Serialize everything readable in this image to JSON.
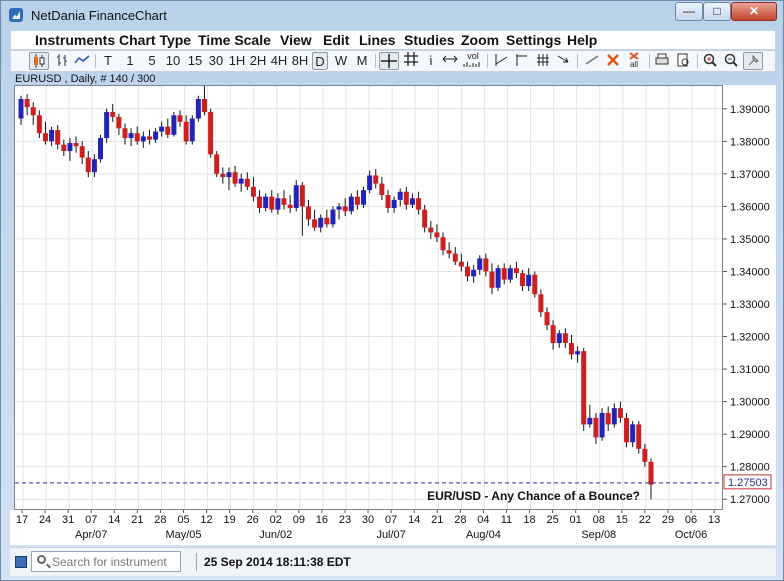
{
  "window": {
    "title": "NetDania FinanceChart",
    "buttons": {
      "minimize": "—",
      "maximize": "□",
      "close": "✕"
    }
  },
  "menu": [
    "Instruments",
    "Chart Type",
    "Time Scale",
    "View",
    "Edit",
    "Lines",
    "Studies",
    "Zoom",
    "Settings",
    "Help"
  ],
  "toolbar": {
    "timescales": [
      "T",
      "1",
      "5",
      "10",
      "15",
      "30",
      "1H",
      "2H",
      "4H",
      "8H",
      "D",
      "W",
      "M"
    ],
    "selected": "D",
    "vol_label": "vol",
    "info_label": "i",
    "all_label": "all"
  },
  "instrument_label": "EURUSD , Daily, # 140 / 300",
  "chart_data": {
    "type": "candlestick",
    "instrument": "EURUSD",
    "period": "Daily",
    "ylim": [
      1.267,
      1.397
    ],
    "y_ticks": [
      "1.39000",
      "1.38000",
      "1.37000",
      "1.36000",
      "1.35000",
      "1.34000",
      "1.33000",
      "1.32000",
      "1.31000",
      "1.30000",
      "1.29000",
      "1.28000",
      "1.27000"
    ],
    "x_ticks": [
      "17",
      "24",
      "31",
      "07",
      "14",
      "21",
      "28",
      "05",
      "12",
      "19",
      "26",
      "02",
      "09",
      "16",
      "23",
      "30",
      "07",
      "14",
      "21",
      "28",
      "04",
      "11",
      "18",
      "25",
      "01",
      "08",
      "15",
      "22",
      "29",
      "06",
      "13"
    ],
    "month_labels": [
      "Apr/07",
      "May/05",
      "Jun/02",
      "Jul/07",
      "Aug/04",
      "Sep/08",
      "Oct/06"
    ],
    "current_price": "1.27503",
    "annotation": "EUR/USD - Any Chance of a Bounce?",
    "up_color": "#2323b8",
    "down_color": "#cc1f1f",
    "ohlc": [
      [
        1.387,
        1.394,
        1.385,
        1.393
      ],
      [
        1.393,
        1.3945,
        1.388,
        1.3905
      ],
      [
        1.3905,
        1.392,
        1.385,
        1.388
      ],
      [
        1.388,
        1.3895,
        1.381,
        1.3825
      ],
      [
        1.3825,
        1.386,
        1.379,
        1.38
      ],
      [
        1.38,
        1.3845,
        1.3785,
        1.3835
      ],
      [
        1.3835,
        1.385,
        1.3775,
        1.379
      ],
      [
        1.379,
        1.3805,
        1.3755,
        1.377
      ],
      [
        1.377,
        1.381,
        1.374,
        1.3795
      ],
      [
        1.3795,
        1.3815,
        1.3765,
        1.3785
      ],
      [
        1.3785,
        1.38,
        1.373,
        1.375
      ],
      [
        1.375,
        1.377,
        1.369,
        1.3705
      ],
      [
        1.3705,
        1.376,
        1.369,
        1.3745
      ],
      [
        1.3745,
        1.382,
        1.3735,
        1.381
      ],
      [
        1.381,
        1.39,
        1.3795,
        1.389
      ],
      [
        1.389,
        1.3915,
        1.386,
        1.3875
      ],
      [
        1.3875,
        1.3885,
        1.382,
        1.384
      ],
      [
        1.384,
        1.3855,
        1.379,
        1.381
      ],
      [
        1.381,
        1.384,
        1.3785,
        1.3825
      ],
      [
        1.3825,
        1.3845,
        1.379,
        1.38
      ],
      [
        1.38,
        1.383,
        1.378,
        1.3815
      ],
      [
        1.3815,
        1.3835,
        1.379,
        1.3805
      ],
      [
        1.3805,
        1.384,
        1.3795,
        1.383
      ],
      [
        1.383,
        1.386,
        1.3815,
        1.3845
      ],
      [
        1.3845,
        1.387,
        1.381,
        1.382
      ],
      [
        1.382,
        1.389,
        1.3815,
        1.388
      ],
      [
        1.388,
        1.3895,
        1.3845,
        1.386
      ],
      [
        1.386,
        1.388,
        1.379,
        1.38
      ],
      [
        1.38,
        1.388,
        1.379,
        1.387
      ],
      [
        1.387,
        1.394,
        1.386,
        1.393
      ],
      [
        1.393,
        1.399,
        1.388,
        1.389
      ],
      [
        1.389,
        1.39,
        1.375,
        1.376
      ],
      [
        1.376,
        1.377,
        1.369,
        1.37
      ],
      [
        1.37,
        1.372,
        1.367,
        1.369
      ],
      [
        1.369,
        1.372,
        1.365,
        1.3705
      ],
      [
        1.3705,
        1.3725,
        1.366,
        1.367
      ],
      [
        1.367,
        1.37,
        1.3645,
        1.3685
      ],
      [
        1.3685,
        1.3705,
        1.365,
        1.366
      ],
      [
        1.366,
        1.369,
        1.3615,
        1.363
      ],
      [
        1.363,
        1.365,
        1.358,
        1.3595
      ],
      [
        1.3595,
        1.364,
        1.3585,
        1.363
      ],
      [
        1.363,
        1.365,
        1.358,
        1.359
      ],
      [
        1.359,
        1.364,
        1.3575,
        1.3625
      ],
      [
        1.3625,
        1.365,
        1.359,
        1.3605
      ],
      [
        1.3605,
        1.3635,
        1.358,
        1.3595
      ],
      [
        1.3595,
        1.368,
        1.3585,
        1.3665
      ],
      [
        1.3665,
        1.3675,
        1.351,
        1.36
      ],
      [
        1.36,
        1.362,
        1.354,
        1.356
      ],
      [
        1.356,
        1.359,
        1.3525,
        1.3535
      ],
      [
        1.3535,
        1.3575,
        1.352,
        1.3565
      ],
      [
        1.3565,
        1.359,
        1.3535,
        1.3545
      ],
      [
        1.3545,
        1.36,
        1.3535,
        1.359
      ],
      [
        1.359,
        1.361,
        1.356,
        1.36
      ],
      [
        1.36,
        1.3625,
        1.357,
        1.3585
      ],
      [
        1.3585,
        1.364,
        1.3575,
        1.363
      ],
      [
        1.363,
        1.365,
        1.359,
        1.3605
      ],
      [
        1.3605,
        1.366,
        1.3595,
        1.365
      ],
      [
        1.365,
        1.371,
        1.364,
        1.3695
      ],
      [
        1.3695,
        1.3715,
        1.3655,
        1.367
      ],
      [
        1.367,
        1.369,
        1.362,
        1.3635
      ],
      [
        1.3635,
        1.365,
        1.358,
        1.3595
      ],
      [
        1.3595,
        1.363,
        1.358,
        1.362
      ],
      [
        1.362,
        1.3655,
        1.36,
        1.3645
      ],
      [
        1.3645,
        1.366,
        1.359,
        1.3605
      ],
      [
        1.3605,
        1.364,
        1.3595,
        1.3625
      ],
      [
        1.3625,
        1.3645,
        1.3575,
        1.359
      ],
      [
        1.359,
        1.3605,
        1.352,
        1.3535
      ],
      [
        1.3535,
        1.3555,
        1.35,
        1.352
      ],
      [
        1.352,
        1.3545,
        1.349,
        1.3505
      ],
      [
        1.3505,
        1.352,
        1.345,
        1.3465
      ],
      [
        1.3465,
        1.349,
        1.344,
        1.3455
      ],
      [
        1.3455,
        1.3475,
        1.342,
        1.343
      ],
      [
        1.343,
        1.3455,
        1.34,
        1.3415
      ],
      [
        1.3415,
        1.343,
        1.337,
        1.3385
      ],
      [
        1.3385,
        1.342,
        1.3365,
        1.3405
      ],
      [
        1.3405,
        1.345,
        1.339,
        1.344
      ],
      [
        1.344,
        1.3455,
        1.3385,
        1.34
      ],
      [
        1.34,
        1.3425,
        1.333,
        1.335
      ],
      [
        1.335,
        1.342,
        1.334,
        1.341
      ],
      [
        1.341,
        1.3425,
        1.336,
        1.3375
      ],
      [
        1.3375,
        1.342,
        1.3365,
        1.341
      ],
      [
        1.341,
        1.343,
        1.338,
        1.3395
      ],
      [
        1.3395,
        1.3405,
        1.334,
        1.3355
      ],
      [
        1.3355,
        1.341,
        1.334,
        1.339
      ],
      [
        1.339,
        1.34,
        1.332,
        1.333
      ],
      [
        1.333,
        1.3345,
        1.326,
        1.3275
      ],
      [
        1.3275,
        1.329,
        1.322,
        1.3235
      ],
      [
        1.3235,
        1.325,
        1.316,
        1.318
      ],
      [
        1.318,
        1.322,
        1.3165,
        1.321
      ],
      [
        1.321,
        1.3225,
        1.3165,
        1.318
      ],
      [
        1.318,
        1.3205,
        1.313,
        1.3145
      ],
      [
        1.3145,
        1.317,
        1.312,
        1.3155
      ],
      [
        1.3155,
        1.3165,
        1.291,
        1.293
      ],
      [
        1.293,
        1.299,
        1.292,
        1.295
      ],
      [
        1.295,
        1.2965,
        1.287,
        1.289
      ],
      [
        1.289,
        1.298,
        1.288,
        1.2965
      ],
      [
        1.2965,
        1.2985,
        1.291,
        1.293
      ],
      [
        1.293,
        1.2995,
        1.292,
        1.298
      ],
      [
        1.298,
        1.3,
        1.2935,
        1.295
      ],
      [
        1.295,
        1.2965,
        1.286,
        1.2875
      ],
      [
        1.2875,
        1.294,
        1.286,
        1.293
      ],
      [
        1.293,
        1.294,
        1.284,
        1.2855
      ],
      [
        1.2855,
        1.287,
        1.28,
        1.2815
      ],
      [
        1.2815,
        1.2825,
        1.27,
        1.2745
      ]
    ]
  },
  "status": {
    "search_placeholder": "Search for instrument",
    "timestamp": "25 Sep 2014 18:11:38 EDT"
  }
}
